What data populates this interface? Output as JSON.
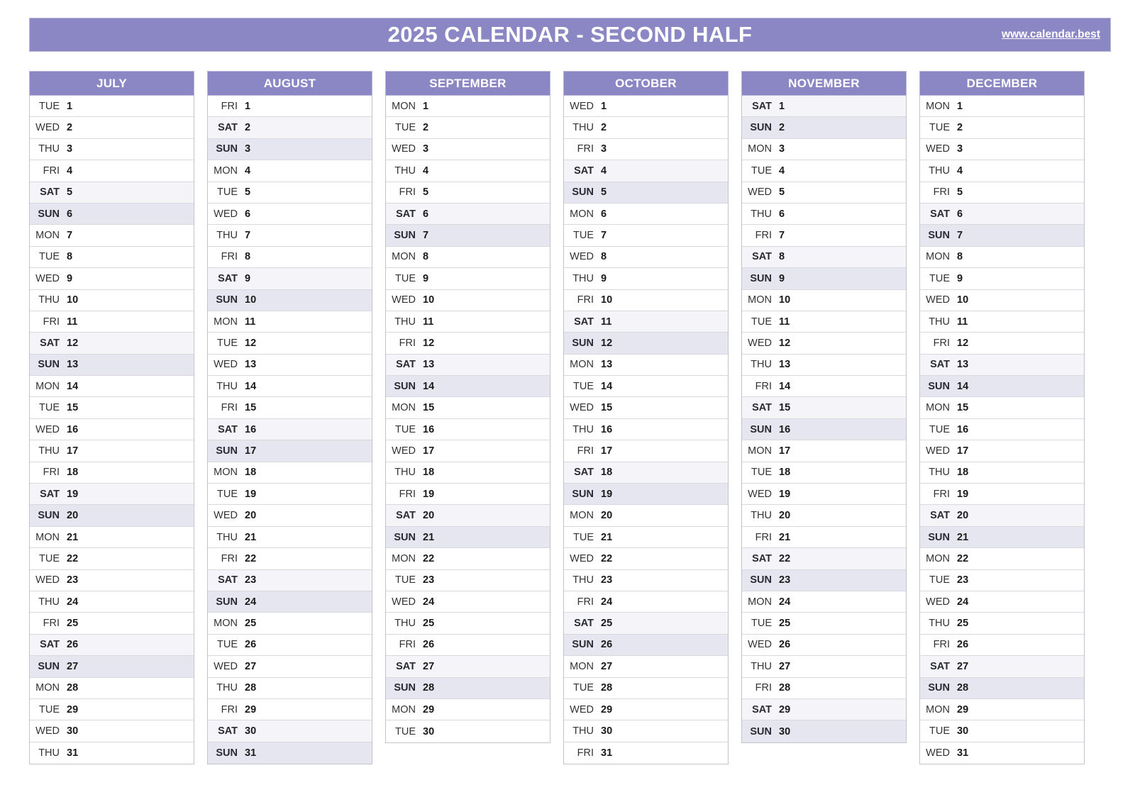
{
  "header": {
    "title": "2025 CALENDAR - SECOND HALF",
    "url": "www.calendar.best",
    "accent_color": "#8b87c4",
    "saturday_color": "#f4f4f9",
    "sunday_color": "#e6e6f0"
  },
  "months": [
    {
      "name": "JULY",
      "days": [
        {
          "dow": "TUE",
          "num": "1"
        },
        {
          "dow": "WED",
          "num": "2"
        },
        {
          "dow": "THU",
          "num": "3"
        },
        {
          "dow": "FRI",
          "num": "4"
        },
        {
          "dow": "SAT",
          "num": "5"
        },
        {
          "dow": "SUN",
          "num": "6"
        },
        {
          "dow": "MON",
          "num": "7"
        },
        {
          "dow": "TUE",
          "num": "8"
        },
        {
          "dow": "WED",
          "num": "9"
        },
        {
          "dow": "THU",
          "num": "10"
        },
        {
          "dow": "FRI",
          "num": "11"
        },
        {
          "dow": "SAT",
          "num": "12"
        },
        {
          "dow": "SUN",
          "num": "13"
        },
        {
          "dow": "MON",
          "num": "14"
        },
        {
          "dow": "TUE",
          "num": "15"
        },
        {
          "dow": "WED",
          "num": "16"
        },
        {
          "dow": "THU",
          "num": "17"
        },
        {
          "dow": "FRI",
          "num": "18"
        },
        {
          "dow": "SAT",
          "num": "19"
        },
        {
          "dow": "SUN",
          "num": "20"
        },
        {
          "dow": "MON",
          "num": "21"
        },
        {
          "dow": "TUE",
          "num": "22"
        },
        {
          "dow": "WED",
          "num": "23"
        },
        {
          "dow": "THU",
          "num": "24"
        },
        {
          "dow": "FRI",
          "num": "25"
        },
        {
          "dow": "SAT",
          "num": "26"
        },
        {
          "dow": "SUN",
          "num": "27"
        },
        {
          "dow": "MON",
          "num": "28"
        },
        {
          "dow": "TUE",
          "num": "29"
        },
        {
          "dow": "WED",
          "num": "30"
        },
        {
          "dow": "THU",
          "num": "31"
        }
      ]
    },
    {
      "name": "AUGUST",
      "days": [
        {
          "dow": "FRI",
          "num": "1"
        },
        {
          "dow": "SAT",
          "num": "2"
        },
        {
          "dow": "SUN",
          "num": "3"
        },
        {
          "dow": "MON",
          "num": "4"
        },
        {
          "dow": "TUE",
          "num": "5"
        },
        {
          "dow": "WED",
          "num": "6"
        },
        {
          "dow": "THU",
          "num": "7"
        },
        {
          "dow": "FRI",
          "num": "8"
        },
        {
          "dow": "SAT",
          "num": "9"
        },
        {
          "dow": "SUN",
          "num": "10"
        },
        {
          "dow": "MON",
          "num": "11"
        },
        {
          "dow": "TUE",
          "num": "12"
        },
        {
          "dow": "WED",
          "num": "13"
        },
        {
          "dow": "THU",
          "num": "14"
        },
        {
          "dow": "FRI",
          "num": "15"
        },
        {
          "dow": "SAT",
          "num": "16"
        },
        {
          "dow": "SUN",
          "num": "17"
        },
        {
          "dow": "MON",
          "num": "18"
        },
        {
          "dow": "TUE",
          "num": "19"
        },
        {
          "dow": "WED",
          "num": "20"
        },
        {
          "dow": "THU",
          "num": "21"
        },
        {
          "dow": "FRI",
          "num": "22"
        },
        {
          "dow": "SAT",
          "num": "23"
        },
        {
          "dow": "SUN",
          "num": "24"
        },
        {
          "dow": "MON",
          "num": "25"
        },
        {
          "dow": "TUE",
          "num": "26"
        },
        {
          "dow": "WED",
          "num": "27"
        },
        {
          "dow": "THU",
          "num": "28"
        },
        {
          "dow": "FRI",
          "num": "29"
        },
        {
          "dow": "SAT",
          "num": "30"
        },
        {
          "dow": "SUN",
          "num": "31"
        }
      ]
    },
    {
      "name": "SEPTEMBER",
      "days": [
        {
          "dow": "MON",
          "num": "1"
        },
        {
          "dow": "TUE",
          "num": "2"
        },
        {
          "dow": "WED",
          "num": "3"
        },
        {
          "dow": "THU",
          "num": "4"
        },
        {
          "dow": "FRI",
          "num": "5"
        },
        {
          "dow": "SAT",
          "num": "6"
        },
        {
          "dow": "SUN",
          "num": "7"
        },
        {
          "dow": "MON",
          "num": "8"
        },
        {
          "dow": "TUE",
          "num": "9"
        },
        {
          "dow": "WED",
          "num": "10"
        },
        {
          "dow": "THU",
          "num": "11"
        },
        {
          "dow": "FRI",
          "num": "12"
        },
        {
          "dow": "SAT",
          "num": "13"
        },
        {
          "dow": "SUN",
          "num": "14"
        },
        {
          "dow": "MON",
          "num": "15"
        },
        {
          "dow": "TUE",
          "num": "16"
        },
        {
          "dow": "WED",
          "num": "17"
        },
        {
          "dow": "THU",
          "num": "18"
        },
        {
          "dow": "FRI",
          "num": "19"
        },
        {
          "dow": "SAT",
          "num": "20"
        },
        {
          "dow": "SUN",
          "num": "21"
        },
        {
          "dow": "MON",
          "num": "22"
        },
        {
          "dow": "TUE",
          "num": "23"
        },
        {
          "dow": "WED",
          "num": "24"
        },
        {
          "dow": "THU",
          "num": "25"
        },
        {
          "dow": "FRI",
          "num": "26"
        },
        {
          "dow": "SAT",
          "num": "27"
        },
        {
          "dow": "SUN",
          "num": "28"
        },
        {
          "dow": "MON",
          "num": "29"
        },
        {
          "dow": "TUE",
          "num": "30"
        }
      ]
    },
    {
      "name": "OCTOBER",
      "days": [
        {
          "dow": "WED",
          "num": "1"
        },
        {
          "dow": "THU",
          "num": "2"
        },
        {
          "dow": "FRI",
          "num": "3"
        },
        {
          "dow": "SAT",
          "num": "4"
        },
        {
          "dow": "SUN",
          "num": "5"
        },
        {
          "dow": "MON",
          "num": "6"
        },
        {
          "dow": "TUE",
          "num": "7"
        },
        {
          "dow": "WED",
          "num": "8"
        },
        {
          "dow": "THU",
          "num": "9"
        },
        {
          "dow": "FRI",
          "num": "10"
        },
        {
          "dow": "SAT",
          "num": "11"
        },
        {
          "dow": "SUN",
          "num": "12"
        },
        {
          "dow": "MON",
          "num": "13"
        },
        {
          "dow": "TUE",
          "num": "14"
        },
        {
          "dow": "WED",
          "num": "15"
        },
        {
          "dow": "THU",
          "num": "16"
        },
        {
          "dow": "FRI",
          "num": "17"
        },
        {
          "dow": "SAT",
          "num": "18"
        },
        {
          "dow": "SUN",
          "num": "19"
        },
        {
          "dow": "MON",
          "num": "20"
        },
        {
          "dow": "TUE",
          "num": "21"
        },
        {
          "dow": "WED",
          "num": "22"
        },
        {
          "dow": "THU",
          "num": "23"
        },
        {
          "dow": "FRI",
          "num": "24"
        },
        {
          "dow": "SAT",
          "num": "25"
        },
        {
          "dow": "SUN",
          "num": "26"
        },
        {
          "dow": "MON",
          "num": "27"
        },
        {
          "dow": "TUE",
          "num": "28"
        },
        {
          "dow": "WED",
          "num": "29"
        },
        {
          "dow": "THU",
          "num": "30"
        },
        {
          "dow": "FRI",
          "num": "31"
        }
      ]
    },
    {
      "name": "NOVEMBER",
      "days": [
        {
          "dow": "SAT",
          "num": "1"
        },
        {
          "dow": "SUN",
          "num": "2"
        },
        {
          "dow": "MON",
          "num": "3"
        },
        {
          "dow": "TUE",
          "num": "4"
        },
        {
          "dow": "WED",
          "num": "5"
        },
        {
          "dow": "THU",
          "num": "6"
        },
        {
          "dow": "FRI",
          "num": "7"
        },
        {
          "dow": "SAT",
          "num": "8"
        },
        {
          "dow": "SUN",
          "num": "9"
        },
        {
          "dow": "MON",
          "num": "10"
        },
        {
          "dow": "TUE",
          "num": "11"
        },
        {
          "dow": "WED",
          "num": "12"
        },
        {
          "dow": "THU",
          "num": "13"
        },
        {
          "dow": "FRI",
          "num": "14"
        },
        {
          "dow": "SAT",
          "num": "15"
        },
        {
          "dow": "SUN",
          "num": "16"
        },
        {
          "dow": "MON",
          "num": "17"
        },
        {
          "dow": "TUE",
          "num": "18"
        },
        {
          "dow": "WED",
          "num": "19"
        },
        {
          "dow": "THU",
          "num": "20"
        },
        {
          "dow": "FRI",
          "num": "21"
        },
        {
          "dow": "SAT",
          "num": "22"
        },
        {
          "dow": "SUN",
          "num": "23"
        },
        {
          "dow": "MON",
          "num": "24"
        },
        {
          "dow": "TUE",
          "num": "25"
        },
        {
          "dow": "WED",
          "num": "26"
        },
        {
          "dow": "THU",
          "num": "27"
        },
        {
          "dow": "FRI",
          "num": "28"
        },
        {
          "dow": "SAT",
          "num": "29"
        },
        {
          "dow": "SUN",
          "num": "30"
        }
      ]
    },
    {
      "name": "DECEMBER",
      "days": [
        {
          "dow": "MON",
          "num": "1"
        },
        {
          "dow": "TUE",
          "num": "2"
        },
        {
          "dow": "WED",
          "num": "3"
        },
        {
          "dow": "THU",
          "num": "4"
        },
        {
          "dow": "FRI",
          "num": "5"
        },
        {
          "dow": "SAT",
          "num": "6"
        },
        {
          "dow": "SUN",
          "num": "7"
        },
        {
          "dow": "MON",
          "num": "8"
        },
        {
          "dow": "TUE",
          "num": "9"
        },
        {
          "dow": "WED",
          "num": "10"
        },
        {
          "dow": "THU",
          "num": "11"
        },
        {
          "dow": "FRI",
          "num": "12"
        },
        {
          "dow": "SAT",
          "num": "13"
        },
        {
          "dow": "SUN",
          "num": "14"
        },
        {
          "dow": "MON",
          "num": "15"
        },
        {
          "dow": "TUE",
          "num": "16"
        },
        {
          "dow": "WED",
          "num": "17"
        },
        {
          "dow": "THU",
          "num": "18"
        },
        {
          "dow": "FRI",
          "num": "19"
        },
        {
          "dow": "SAT",
          "num": "20"
        },
        {
          "dow": "SUN",
          "num": "21"
        },
        {
          "dow": "MON",
          "num": "22"
        },
        {
          "dow": "TUE",
          "num": "23"
        },
        {
          "dow": "WED",
          "num": "24"
        },
        {
          "dow": "THU",
          "num": "25"
        },
        {
          "dow": "FRI",
          "num": "26"
        },
        {
          "dow": "SAT",
          "num": "27"
        },
        {
          "dow": "SUN",
          "num": "28"
        },
        {
          "dow": "MON",
          "num": "29"
        },
        {
          "dow": "TUE",
          "num": "30"
        },
        {
          "dow": "WED",
          "num": "31"
        }
      ]
    }
  ]
}
